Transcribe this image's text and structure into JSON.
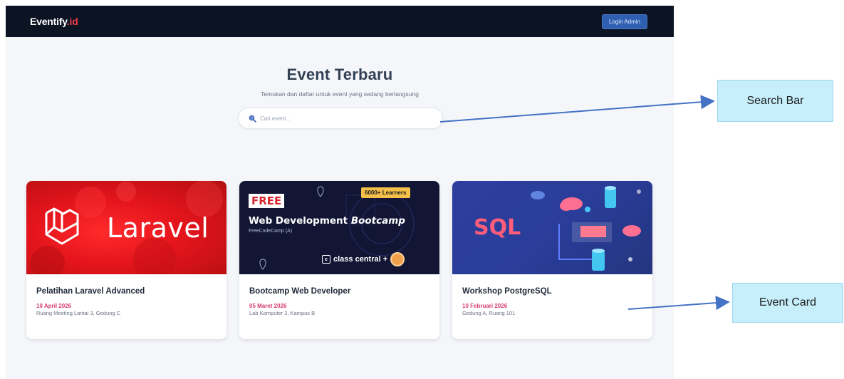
{
  "navbar": {
    "brand_main": "Eventify",
    "brand_accent": ".id",
    "login_label": "Login Admin"
  },
  "hero": {
    "title": "Event Terbaru",
    "subtitle": "Temukan dan daftar untuk event yang sedang berlangsung"
  },
  "search": {
    "placeholder": "Cari event..."
  },
  "events": [
    {
      "title": "Pelatihan Laravel Advanced",
      "date": "10 April 2026",
      "location": "Ruang Meeting Lantai 3, Gedung C",
      "banner_text": "Laravel"
    },
    {
      "title": "Bootcamp Web Developer",
      "date": "05 Maret 2026",
      "location": "Lab Komputer 2, Kampus B",
      "banner": {
        "free": "FREE",
        "learners": "6000+ Learners",
        "headline": "Web Development",
        "headline_italic": "Bootcamp",
        "sub": "FreeCodeCamp (A)",
        "provider": "class central +"
      }
    },
    {
      "title": "Workshop PostgreSQL",
      "date": "10 Februari 2026",
      "location": "Gedung A, Ruang 101",
      "banner_text": "SQL"
    }
  ],
  "annotations": {
    "search_bar": "Search Bar",
    "event_card": "Event Card"
  },
  "colors": {
    "navbar_bg": "#0c1322",
    "brand_accent": "#ef3a4a",
    "login_button": "#2f5fb0",
    "date_text": "#d63a6b",
    "callout_bg": "#c6eefb",
    "arrow": "#4472c4"
  }
}
